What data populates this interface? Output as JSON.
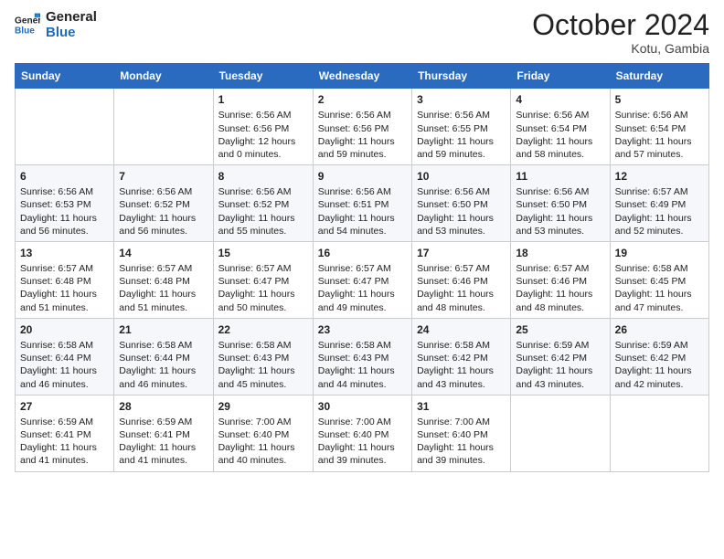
{
  "logo": {
    "text_general": "General",
    "text_blue": "Blue"
  },
  "title": "October 2024",
  "location": "Kotu, Gambia",
  "headers": [
    "Sunday",
    "Monday",
    "Tuesday",
    "Wednesday",
    "Thursday",
    "Friday",
    "Saturday"
  ],
  "weeks": [
    [
      {
        "day": "",
        "info": ""
      },
      {
        "day": "",
        "info": ""
      },
      {
        "day": "1",
        "info": "Sunrise: 6:56 AM\nSunset: 6:56 PM\nDaylight: 12 hours\nand 0 minutes."
      },
      {
        "day": "2",
        "info": "Sunrise: 6:56 AM\nSunset: 6:56 PM\nDaylight: 11 hours\nand 59 minutes."
      },
      {
        "day": "3",
        "info": "Sunrise: 6:56 AM\nSunset: 6:55 PM\nDaylight: 11 hours\nand 59 minutes."
      },
      {
        "day": "4",
        "info": "Sunrise: 6:56 AM\nSunset: 6:54 PM\nDaylight: 11 hours\nand 58 minutes."
      },
      {
        "day": "5",
        "info": "Sunrise: 6:56 AM\nSunset: 6:54 PM\nDaylight: 11 hours\nand 57 minutes."
      }
    ],
    [
      {
        "day": "6",
        "info": "Sunrise: 6:56 AM\nSunset: 6:53 PM\nDaylight: 11 hours\nand 56 minutes."
      },
      {
        "day": "7",
        "info": "Sunrise: 6:56 AM\nSunset: 6:52 PM\nDaylight: 11 hours\nand 56 minutes."
      },
      {
        "day": "8",
        "info": "Sunrise: 6:56 AM\nSunset: 6:52 PM\nDaylight: 11 hours\nand 55 minutes."
      },
      {
        "day": "9",
        "info": "Sunrise: 6:56 AM\nSunset: 6:51 PM\nDaylight: 11 hours\nand 54 minutes."
      },
      {
        "day": "10",
        "info": "Sunrise: 6:56 AM\nSunset: 6:50 PM\nDaylight: 11 hours\nand 53 minutes."
      },
      {
        "day": "11",
        "info": "Sunrise: 6:56 AM\nSunset: 6:50 PM\nDaylight: 11 hours\nand 53 minutes."
      },
      {
        "day": "12",
        "info": "Sunrise: 6:57 AM\nSunset: 6:49 PM\nDaylight: 11 hours\nand 52 minutes."
      }
    ],
    [
      {
        "day": "13",
        "info": "Sunrise: 6:57 AM\nSunset: 6:48 PM\nDaylight: 11 hours\nand 51 minutes."
      },
      {
        "day": "14",
        "info": "Sunrise: 6:57 AM\nSunset: 6:48 PM\nDaylight: 11 hours\nand 51 minutes."
      },
      {
        "day": "15",
        "info": "Sunrise: 6:57 AM\nSunset: 6:47 PM\nDaylight: 11 hours\nand 50 minutes."
      },
      {
        "day": "16",
        "info": "Sunrise: 6:57 AM\nSunset: 6:47 PM\nDaylight: 11 hours\nand 49 minutes."
      },
      {
        "day": "17",
        "info": "Sunrise: 6:57 AM\nSunset: 6:46 PM\nDaylight: 11 hours\nand 48 minutes."
      },
      {
        "day": "18",
        "info": "Sunrise: 6:57 AM\nSunset: 6:46 PM\nDaylight: 11 hours\nand 48 minutes."
      },
      {
        "day": "19",
        "info": "Sunrise: 6:58 AM\nSunset: 6:45 PM\nDaylight: 11 hours\nand 47 minutes."
      }
    ],
    [
      {
        "day": "20",
        "info": "Sunrise: 6:58 AM\nSunset: 6:44 PM\nDaylight: 11 hours\nand 46 minutes."
      },
      {
        "day": "21",
        "info": "Sunrise: 6:58 AM\nSunset: 6:44 PM\nDaylight: 11 hours\nand 46 minutes."
      },
      {
        "day": "22",
        "info": "Sunrise: 6:58 AM\nSunset: 6:43 PM\nDaylight: 11 hours\nand 45 minutes."
      },
      {
        "day": "23",
        "info": "Sunrise: 6:58 AM\nSunset: 6:43 PM\nDaylight: 11 hours\nand 44 minutes."
      },
      {
        "day": "24",
        "info": "Sunrise: 6:58 AM\nSunset: 6:42 PM\nDaylight: 11 hours\nand 43 minutes."
      },
      {
        "day": "25",
        "info": "Sunrise: 6:59 AM\nSunset: 6:42 PM\nDaylight: 11 hours\nand 43 minutes."
      },
      {
        "day": "26",
        "info": "Sunrise: 6:59 AM\nSunset: 6:42 PM\nDaylight: 11 hours\nand 42 minutes."
      }
    ],
    [
      {
        "day": "27",
        "info": "Sunrise: 6:59 AM\nSunset: 6:41 PM\nDaylight: 11 hours\nand 41 minutes."
      },
      {
        "day": "28",
        "info": "Sunrise: 6:59 AM\nSunset: 6:41 PM\nDaylight: 11 hours\nand 41 minutes."
      },
      {
        "day": "29",
        "info": "Sunrise: 7:00 AM\nSunset: 6:40 PM\nDaylight: 11 hours\nand 40 minutes."
      },
      {
        "day": "30",
        "info": "Sunrise: 7:00 AM\nSunset: 6:40 PM\nDaylight: 11 hours\nand 39 minutes."
      },
      {
        "day": "31",
        "info": "Sunrise: 7:00 AM\nSunset: 6:40 PM\nDaylight: 11 hours\nand 39 minutes."
      },
      {
        "day": "",
        "info": ""
      },
      {
        "day": "",
        "info": ""
      }
    ]
  ]
}
